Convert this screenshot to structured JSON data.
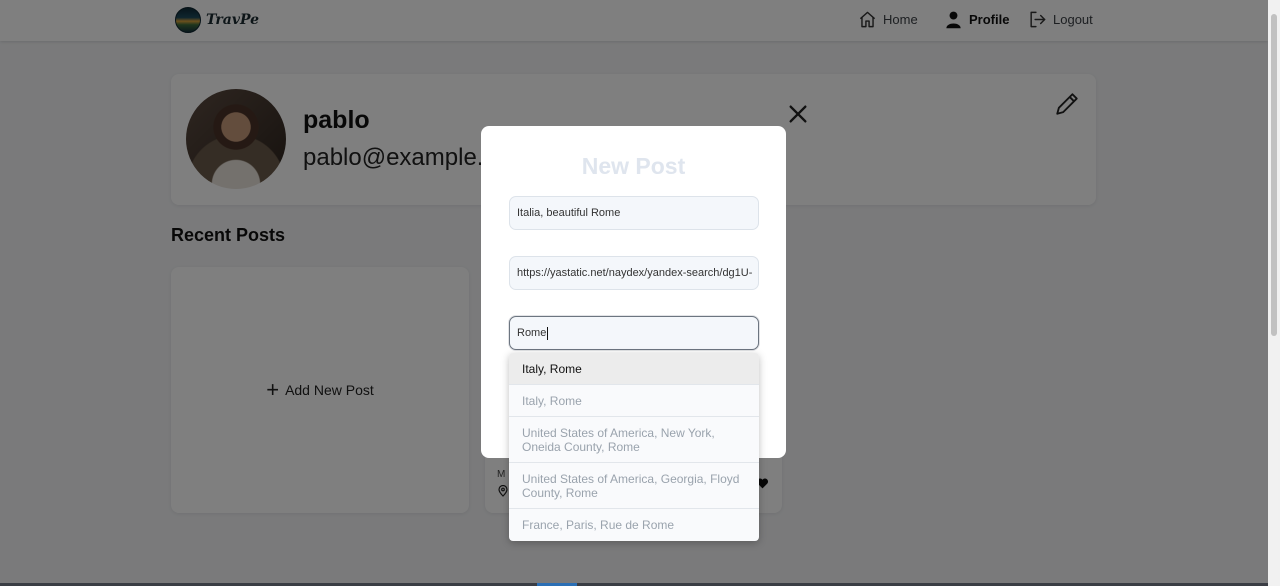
{
  "app": {
    "name": "TravPe"
  },
  "nav": {
    "home_label": "Home",
    "profile_label": "Profile",
    "logout_label": "Logout"
  },
  "profile": {
    "username": "pablo",
    "email": "pablo@example.com"
  },
  "recent_posts": {
    "title": "Recent Posts",
    "add_label": "Add New Post",
    "card_fragment": "M"
  },
  "modal": {
    "title": "New Post",
    "title_value": "Italia, beautiful Rome",
    "url_value": "https://yastatic.net/naydex/yandex-search/dg1U-",
    "location_value": "Rome"
  },
  "suggestions": [
    "Italy, Rome",
    "Italy, Rome",
    "United States of America, New York, Oneida County, Rome",
    "United States of America, Georgia, Floyd County, Rome",
    "France, Paris, Rue de Rome"
  ],
  "colors": {
    "overlay": "rgba(0,0,0,0.5)",
    "modal_title": "#dfe5ee",
    "suggestion_active_bg": "#ececec",
    "suggestion_text": "#9aa3ad"
  },
  "icons": {
    "home": "home-icon",
    "profile": "user-icon",
    "logout": "logout-icon",
    "edit": "pencil-icon",
    "close": "close-icon",
    "add": "plus-icon"
  }
}
